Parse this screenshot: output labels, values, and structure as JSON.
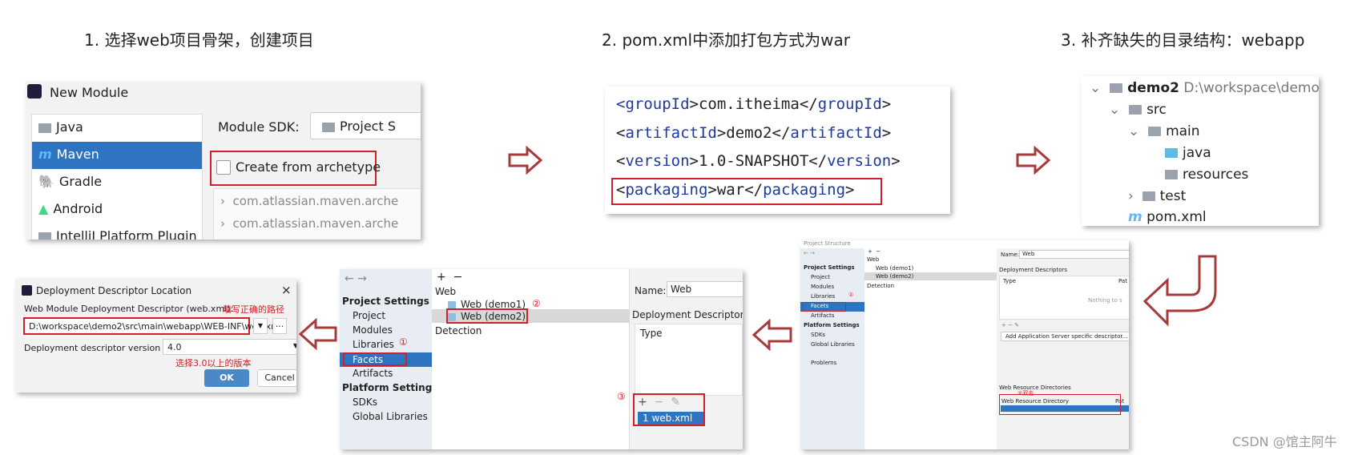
{
  "steps": {
    "s1": "1. 选择web项目骨架，创建项目",
    "s2": "2. pom.xml中添加打包方式为war",
    "s3": "3. 补齐缺失的目录结构：webapp"
  },
  "new_module": {
    "title": "New Module",
    "types": [
      "Java",
      "Maven",
      "Gradle",
      "Android",
      "IntelliJ Platform Plugin"
    ],
    "selected": "Maven",
    "sdk_label": "Module SDK:",
    "sdk_value": "Project S",
    "archetype_checkbox": "Create from archetype",
    "archetype_checked": false,
    "archetypes": [
      "com.atlassian.maven.arche",
      "com.atlassian.maven.arche"
    ]
  },
  "pom": {
    "lines": [
      {
        "tag": "groupId",
        "value": "com.itheima"
      },
      {
        "tag": "artifactId",
        "value": "demo2"
      },
      {
        "tag": "version",
        "value": "1.0-SNAPSHOT"
      },
      {
        "tag": "packaging",
        "value": "war"
      }
    ]
  },
  "tree": {
    "root": "demo2",
    "root_path": "D:\\workspace\\demo2",
    "src": "src",
    "main": "main",
    "java": "java",
    "resources": "resources",
    "test": "test",
    "pom": "pom.xml"
  },
  "dialog": {
    "title": "Deployment Descriptor Location",
    "close": "×",
    "descriptor_label": "Web Module Deployment Descriptor (web.xml):",
    "descriptor_hint": "填写正确的路径",
    "descriptor_value": "D:\\workspace\\demo2\\src\\main\\webapp\\WEB-INF\\web.xml",
    "browse": "...",
    "version_label": "Deployment descriptor version",
    "version_value": "4.0",
    "version_hint": "选择3.0以上的版本",
    "ok": "OK",
    "cancel": "Cancel"
  },
  "facets": {
    "project_settings": "Project Settings",
    "nav": [
      "Project",
      "Modules",
      "Libraries",
      "Facets",
      "Artifacts"
    ],
    "platform_settings": "Platform Settings",
    "platform_nav": [
      "SDKs",
      "Global Libraries"
    ],
    "problems": "Problems",
    "group": "Web",
    "items": [
      "Web (demo1)",
      "Web (demo2)"
    ],
    "detection": "Detection",
    "name_label": "Name:",
    "name_value": "Web",
    "descriptors": "Deployment Descriptors",
    "type_col": "Type",
    "path_col": "Pat",
    "nothing": "Nothing to s",
    "webxml_item": "1  web.xml",
    "server_btn": "Add Application Server specific descriptor...",
    "web_res": "Web Resource Directories",
    "web_res_col": "Web Resource Directory",
    "mark1": "①",
    "mark2": "②",
    "mark3": "③",
    "mark_dbl": "②双击",
    "window_title": "Project Structure"
  },
  "watermark": "CSDN @馆主阿牛",
  "colors": {
    "accent": "#2f74c0",
    "highlight": "#d0202a",
    "arrow": "#a8393a",
    "tag": "#1d3a9e"
  }
}
